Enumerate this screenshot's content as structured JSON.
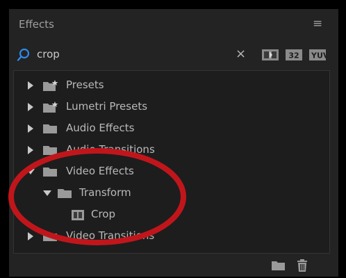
{
  "panel": {
    "title": "Effects",
    "menu_icon": "panel-menu-icon"
  },
  "search": {
    "value": "crop",
    "clear_label": "×"
  },
  "filters": [
    {
      "name": "accelerated-effects-filter",
      "label": ""
    },
    {
      "name": "32-bit-color-filter",
      "label": "32"
    },
    {
      "name": "yuv-filter",
      "label": "YUV"
    }
  ],
  "tree": {
    "items": [
      {
        "label": "Presets",
        "expanded": false
      },
      {
        "label": "Lumetri Presets",
        "expanded": false
      },
      {
        "label": "Audio Effects",
        "expanded": false
      },
      {
        "label": "Audio Transitions",
        "expanded": false
      },
      {
        "label": "Video Effects",
        "expanded": true
      },
      {
        "label": "Transform",
        "expanded": true
      },
      {
        "label": "Crop",
        "expanded": false
      },
      {
        "label": "Video Transitions",
        "expanded": false
      }
    ]
  },
  "bottom": {
    "new_bin_icon": "new-custom-bin-icon",
    "delete_icon": "trash-icon"
  },
  "annotation": {
    "color": "#c0161b"
  }
}
